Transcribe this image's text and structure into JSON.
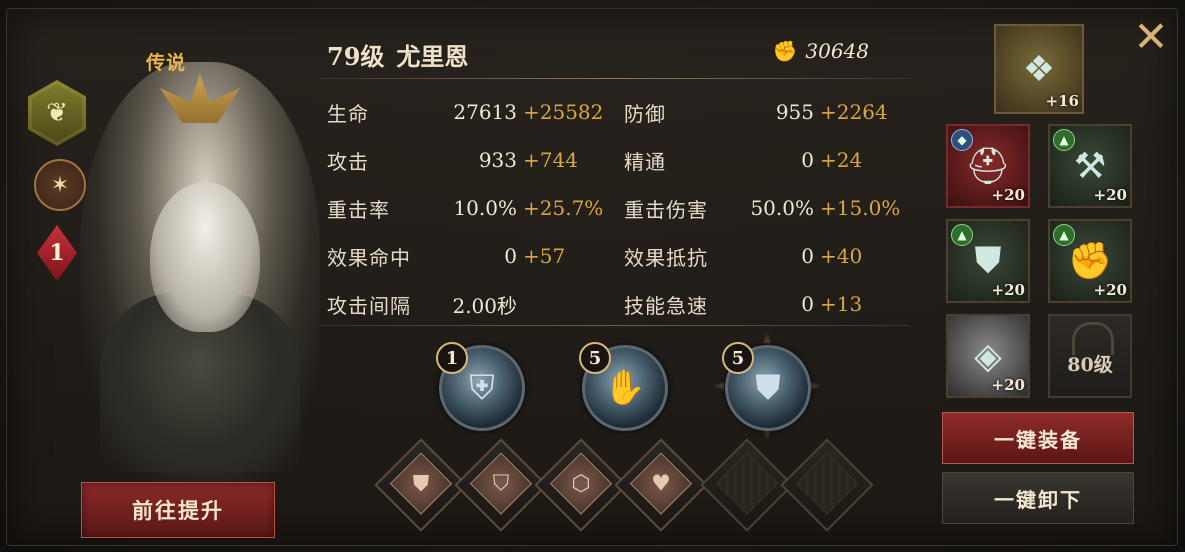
{
  "hero": {
    "rarity": "传说",
    "rank": "1",
    "level_label": "79级",
    "name": "尤里恩",
    "power": "30648",
    "upgrade_label": "前往提升"
  },
  "stats": [
    {
      "label": "生命",
      "value": "27613",
      "bonus": "+25582"
    },
    {
      "label": "防御",
      "value": "955",
      "bonus": "+2264"
    },
    {
      "label": "攻击",
      "value": "933",
      "bonus": "+744"
    },
    {
      "label": "精通",
      "value": "0",
      "bonus": "+24"
    },
    {
      "label": "重击率",
      "value": "10.0%",
      "bonus": "+25.7%"
    },
    {
      "label": "重击伤害",
      "value": "50.0%",
      "bonus": "+15.0%"
    },
    {
      "label": "效果命中",
      "value": "0",
      "bonus": "+57"
    },
    {
      "label": "效果抵抗",
      "value": "0",
      "bonus": "+40"
    },
    {
      "label": "攻击间隔",
      "value": "2.00秒",
      "bonus": ""
    },
    {
      "label": "技能急速",
      "value": "0",
      "bonus": "+13"
    }
  ],
  "skills": [
    {
      "level": "1",
      "icon": "shield-skill-icon"
    },
    {
      "level": "5",
      "icon": "claw-skill-icon"
    },
    {
      "level": "5",
      "icon": "armor-skill-icon"
    }
  ],
  "runes": [
    {
      "icon": "shield-rune-icon",
      "glyph": "⛊",
      "filled": true
    },
    {
      "icon": "guard-rune-icon",
      "glyph": "⛉",
      "filled": true
    },
    {
      "icon": "defense-rune-icon",
      "glyph": "⬡",
      "filled": true
    },
    {
      "icon": "heart-rune-icon",
      "glyph": "♥",
      "filled": true
    },
    {
      "icon": "empty-rune-slot",
      "glyph": "",
      "filled": false
    },
    {
      "icon": "empty-rune-slot",
      "glyph": "",
      "filled": false
    }
  ],
  "equipment": {
    "top": {
      "level": "+16",
      "icon": "beetle-artifact-icon"
    },
    "items": [
      {
        "level": "+20",
        "icon": "helmet-icon"
      },
      {
        "level": "+20",
        "icon": "axe-icon"
      },
      {
        "level": "+20",
        "icon": "chest-armor-icon"
      },
      {
        "level": "+20",
        "icon": "gauntlet-icon"
      },
      {
        "level": "+20",
        "icon": "gem-icon"
      }
    ],
    "locked_label": "80级",
    "equip_all_label": "一键装备",
    "unequip_all_label": "一键卸下"
  },
  "colors": {
    "bonus": "#d9a742",
    "rarity": "#e9b74a",
    "button_red": "#8a2b2a"
  }
}
